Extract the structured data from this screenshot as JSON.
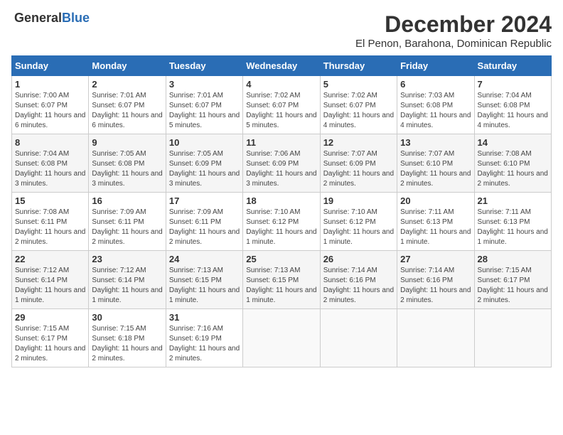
{
  "header": {
    "logo": {
      "general": "General",
      "blue": "Blue"
    },
    "title": "December 2024",
    "location": "El Penon, Barahona, Dominican Republic"
  },
  "calendar": {
    "weekdays": [
      "Sunday",
      "Monday",
      "Tuesday",
      "Wednesday",
      "Thursday",
      "Friday",
      "Saturday"
    ],
    "weeks": [
      [
        {
          "day": "1",
          "sunrise": "7:00 AM",
          "sunset": "6:07 PM",
          "daylight": "11 hours and 6 minutes."
        },
        {
          "day": "2",
          "sunrise": "7:01 AM",
          "sunset": "6:07 PM",
          "daylight": "11 hours and 6 minutes."
        },
        {
          "day": "3",
          "sunrise": "7:01 AM",
          "sunset": "6:07 PM",
          "daylight": "11 hours and 5 minutes."
        },
        {
          "day": "4",
          "sunrise": "7:02 AM",
          "sunset": "6:07 PM",
          "daylight": "11 hours and 5 minutes."
        },
        {
          "day": "5",
          "sunrise": "7:02 AM",
          "sunset": "6:07 PM",
          "daylight": "11 hours and 4 minutes."
        },
        {
          "day": "6",
          "sunrise": "7:03 AM",
          "sunset": "6:08 PM",
          "daylight": "11 hours and 4 minutes."
        },
        {
          "day": "7",
          "sunrise": "7:04 AM",
          "sunset": "6:08 PM",
          "daylight": "11 hours and 4 minutes."
        }
      ],
      [
        {
          "day": "8",
          "sunrise": "7:04 AM",
          "sunset": "6:08 PM",
          "daylight": "11 hours and 3 minutes."
        },
        {
          "day": "9",
          "sunrise": "7:05 AM",
          "sunset": "6:08 PM",
          "daylight": "11 hours and 3 minutes."
        },
        {
          "day": "10",
          "sunrise": "7:05 AM",
          "sunset": "6:09 PM",
          "daylight": "11 hours and 3 minutes."
        },
        {
          "day": "11",
          "sunrise": "7:06 AM",
          "sunset": "6:09 PM",
          "daylight": "11 hours and 3 minutes."
        },
        {
          "day": "12",
          "sunrise": "7:07 AM",
          "sunset": "6:09 PM",
          "daylight": "11 hours and 2 minutes."
        },
        {
          "day": "13",
          "sunrise": "7:07 AM",
          "sunset": "6:10 PM",
          "daylight": "11 hours and 2 minutes."
        },
        {
          "day": "14",
          "sunrise": "7:08 AM",
          "sunset": "6:10 PM",
          "daylight": "11 hours and 2 minutes."
        }
      ],
      [
        {
          "day": "15",
          "sunrise": "7:08 AM",
          "sunset": "6:11 PM",
          "daylight": "11 hours and 2 minutes."
        },
        {
          "day": "16",
          "sunrise": "7:09 AM",
          "sunset": "6:11 PM",
          "daylight": "11 hours and 2 minutes."
        },
        {
          "day": "17",
          "sunrise": "7:09 AM",
          "sunset": "6:11 PM",
          "daylight": "11 hours and 2 minutes."
        },
        {
          "day": "18",
          "sunrise": "7:10 AM",
          "sunset": "6:12 PM",
          "daylight": "11 hours and 1 minute."
        },
        {
          "day": "19",
          "sunrise": "7:10 AM",
          "sunset": "6:12 PM",
          "daylight": "11 hours and 1 minute."
        },
        {
          "day": "20",
          "sunrise": "7:11 AM",
          "sunset": "6:13 PM",
          "daylight": "11 hours and 1 minute."
        },
        {
          "day": "21",
          "sunrise": "7:11 AM",
          "sunset": "6:13 PM",
          "daylight": "11 hours and 1 minute."
        }
      ],
      [
        {
          "day": "22",
          "sunrise": "7:12 AM",
          "sunset": "6:14 PM",
          "daylight": "11 hours and 1 minute."
        },
        {
          "day": "23",
          "sunrise": "7:12 AM",
          "sunset": "6:14 PM",
          "daylight": "11 hours and 1 minute."
        },
        {
          "day": "24",
          "sunrise": "7:13 AM",
          "sunset": "6:15 PM",
          "daylight": "11 hours and 1 minute."
        },
        {
          "day": "25",
          "sunrise": "7:13 AM",
          "sunset": "6:15 PM",
          "daylight": "11 hours and 1 minute."
        },
        {
          "day": "26",
          "sunrise": "7:14 AM",
          "sunset": "6:16 PM",
          "daylight": "11 hours and 2 minutes."
        },
        {
          "day": "27",
          "sunrise": "7:14 AM",
          "sunset": "6:16 PM",
          "daylight": "11 hours and 2 minutes."
        },
        {
          "day": "28",
          "sunrise": "7:15 AM",
          "sunset": "6:17 PM",
          "daylight": "11 hours and 2 minutes."
        }
      ],
      [
        {
          "day": "29",
          "sunrise": "7:15 AM",
          "sunset": "6:17 PM",
          "daylight": "11 hours and 2 minutes."
        },
        {
          "day": "30",
          "sunrise": "7:15 AM",
          "sunset": "6:18 PM",
          "daylight": "11 hours and 2 minutes."
        },
        {
          "day": "31",
          "sunrise": "7:16 AM",
          "sunset": "6:19 PM",
          "daylight": "11 hours and 2 minutes."
        },
        null,
        null,
        null,
        null
      ]
    ]
  }
}
